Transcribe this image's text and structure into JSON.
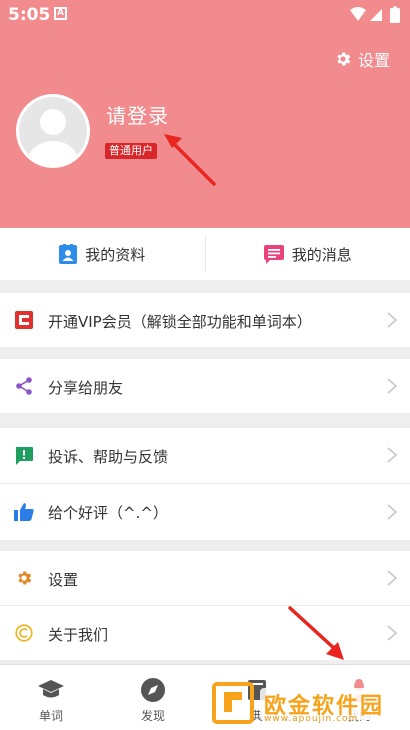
{
  "status_bar": {
    "time": "5:05",
    "notif_letter": "A"
  },
  "header": {
    "settings_label": "设置",
    "login_title": "请登录",
    "user_badge": "普通用户",
    "background_color": "#f28b8e"
  },
  "top_tabs": [
    {
      "label": "我的资料",
      "icon": "profile-card-icon",
      "color": "#2b8de8"
    },
    {
      "label": "我的消息",
      "icon": "message-icon",
      "color": "#e8437a"
    }
  ],
  "menu": {
    "vip": {
      "label": "开通VIP会员（解锁全部功能和单词本）",
      "icon": "vip-icon",
      "color": "#e03030"
    },
    "share": {
      "label": "分享给朋友",
      "icon": "share-icon",
      "color": "#8a55c8"
    },
    "feedback": {
      "label": "投诉、帮助与反馈",
      "icon": "feedback-icon",
      "color": "#20a060"
    },
    "rate": {
      "label": "给个好评（^.^）",
      "icon": "thumbs-up-icon",
      "color": "#2d7de8"
    },
    "settings": {
      "label": "设置",
      "icon": "gear-icon",
      "color": "#e08a2a"
    },
    "about": {
      "label": "关于我们",
      "icon": "copyright-icon",
      "color": "#f0b21a"
    }
  },
  "bottom_nav": [
    {
      "label": "单词",
      "icon": "graduation-cap-icon"
    },
    {
      "label": "发现",
      "icon": "compass-icon"
    },
    {
      "label": "典",
      "icon": "book-icon"
    },
    {
      "label": "我的",
      "icon": "person-icon"
    }
  ],
  "watermark": {
    "text": "欧金软件园",
    "url": "www.apoujin.com"
  }
}
